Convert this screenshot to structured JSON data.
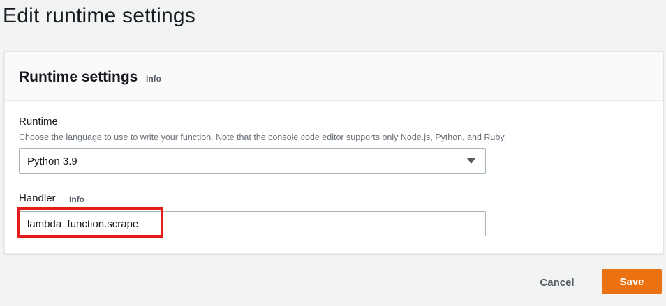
{
  "page": {
    "title": "Edit runtime settings"
  },
  "panel": {
    "title": "Runtime settings",
    "info_label": "Info"
  },
  "runtime": {
    "label": "Runtime",
    "description": "Choose the language to use to write your function. Note that the console code editor supports only Node.js, Python, and Ruby.",
    "selected": "Python 3.9"
  },
  "handler": {
    "label": "Handler",
    "info_label": "Info",
    "value": "lambda_function.scrape",
    "highlighted": true
  },
  "actions": {
    "cancel_label": "Cancel",
    "save_label": "Save"
  },
  "colors": {
    "primary_button": "#ec7211",
    "highlight": "#e31b1b",
    "background": "#f2f3f3"
  }
}
